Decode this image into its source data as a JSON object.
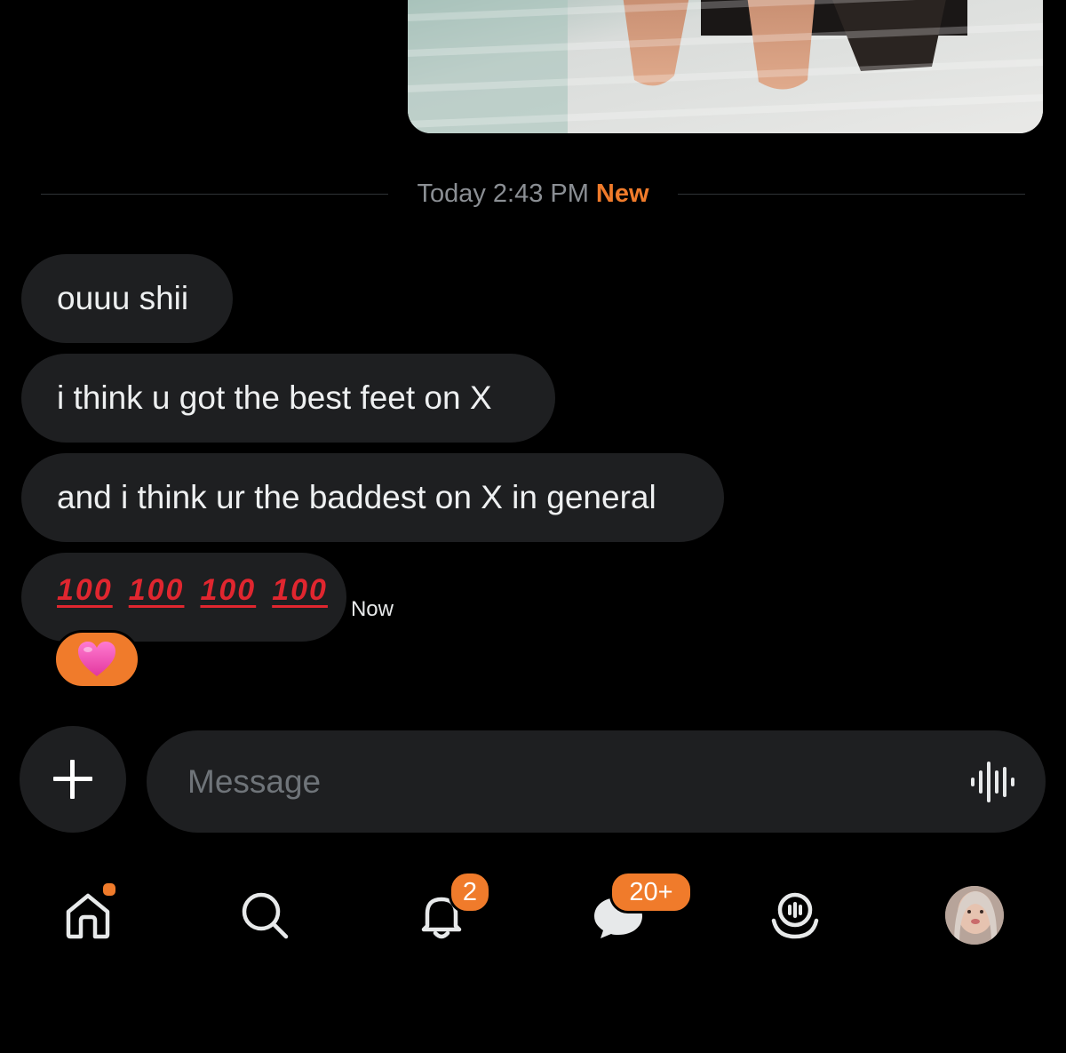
{
  "image_message": {
    "icon": "photo-attachment"
  },
  "divider": {
    "date_label": "Today 2:43 PM",
    "new_label": "New"
  },
  "messages": [
    {
      "text": "ouuu shii"
    },
    {
      "text": "i think u got the best feet on X"
    },
    {
      "text": "and i think ur the baddest on X in general"
    },
    {
      "emoji_text": [
        "100",
        "100",
        "100",
        "100"
      ],
      "time": "Now"
    }
  ],
  "reaction": {
    "emoji": "💗",
    "color": "#f07b2b"
  },
  "composer": {
    "add_icon": "plus-icon",
    "placeholder": "Message",
    "voice_icon": "voice-waveform-icon"
  },
  "nav": {
    "items": [
      {
        "name": "home",
        "icon": "home-icon",
        "has_dot": true
      },
      {
        "name": "search",
        "icon": "search-icon"
      },
      {
        "name": "notifications",
        "icon": "bell-icon",
        "badge": "2"
      },
      {
        "name": "messages",
        "icon": "messages-icon",
        "badge": "20+"
      },
      {
        "name": "spaces",
        "icon": "spaces-icon"
      },
      {
        "name": "profile",
        "icon": "avatar"
      }
    ]
  },
  "colors": {
    "background": "#000000",
    "bubble": "#1e1f21",
    "accent": "#f07b2b",
    "text": "#e7e9ea",
    "muted": "#8b8f94"
  }
}
